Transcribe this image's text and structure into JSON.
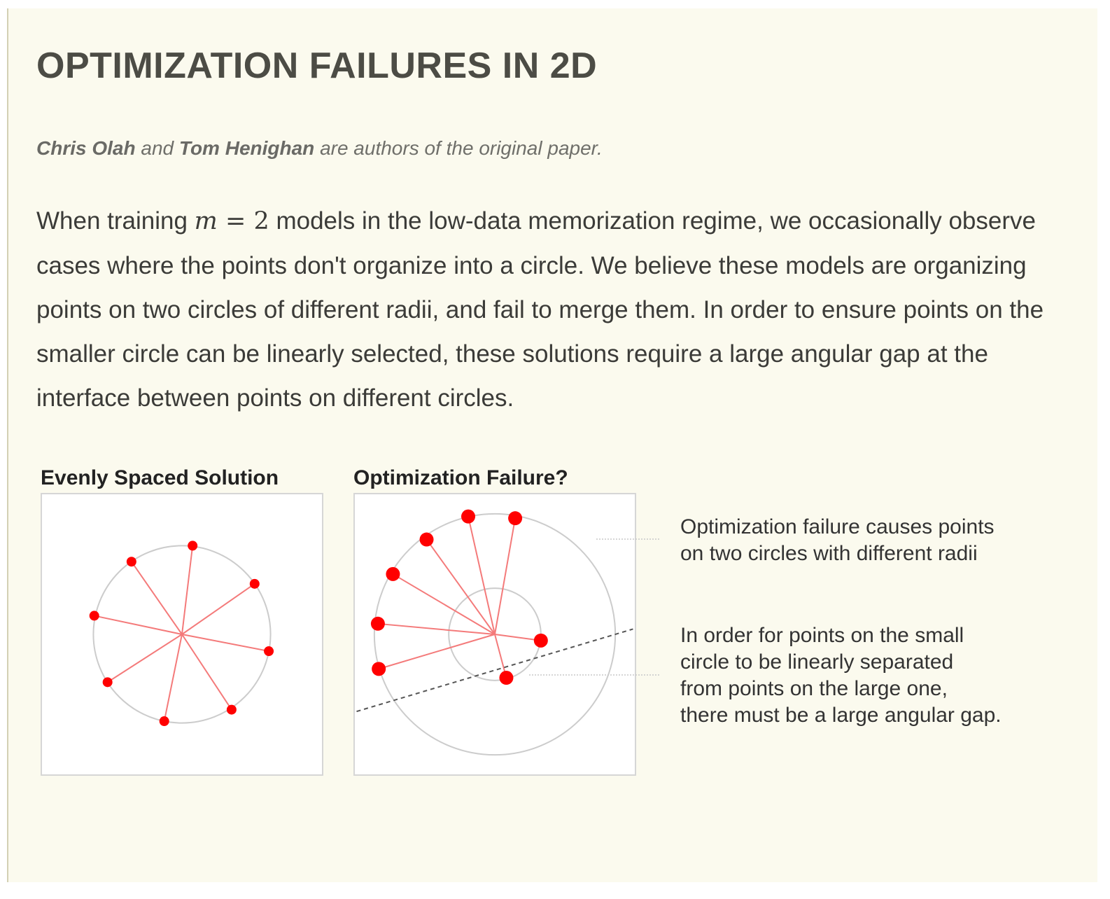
{
  "page": {
    "title": "OPTIMIZATION FAILURES IN 2D",
    "byline": {
      "author1": "Chris Olah",
      "connector": "and",
      "author2": "Tom Henighan",
      "rest": "are authors of the original paper."
    },
    "paragraph": {
      "before_math": "When training ",
      "math_var": "m",
      "math_op": " = ",
      "math_val": "2",
      "after_math": " models in the low-data memorization regime, we occasionally observe cases where the points don't organize into a circle. We believe these models are organizing points on two circles of different radii, and fail to merge them. In order to ensure points on the smaller circle can be linearly selected, these solutions require a large angular gap at the interface between points on different circles."
    }
  },
  "figures": {
    "left_title": "Evenly Spaced Solution",
    "right_title": "Optimization Failure?",
    "annotation_1": [
      "Optimization failure causes points",
      "on two circles with different radii"
    ],
    "annotation_2": [
      "In order for points on the small",
      "circle to be linearly separated",
      "from points on the large one,",
      "there must be a large angular gap."
    ]
  },
  "colors": {
    "point": "#ff0000",
    "spoke": "#f47a7a",
    "circle": "#cccccc",
    "separator": "#555555",
    "leader": "#c8c8c8"
  },
  "icons": {
    "point_marker": "filled-circle",
    "separator_line": "dashed-line"
  },
  "chart_data": [
    {
      "type": "scatter",
      "title": "Evenly Spaced Solution",
      "description_of_layout": "",
      "points": [
        {
          "x": 0.12,
          "y": 1.0
        },
        {
          "x": 0.82,
          "y": 0.57
        },
        {
          "x": 0.98,
          "y": -0.19
        },
        {
          "x": 0.56,
          "y": -0.85
        },
        {
          "x": -0.2,
          "y": -0.98
        },
        {
          "x": -0.84,
          "y": -0.54
        },
        {
          "x": -0.99,
          "y": 0.21
        },
        {
          "x": -0.57,
          "y": 0.82
        }
      ],
      "circles": [
        {
          "radius": 1.0
        }
      ],
      "xlim": [
        -1.58,
        1.58
      ],
      "ylim": [
        -1.58,
        1.58
      ]
    },
    {
      "type": "scatter",
      "title": "Optimization Failure?",
      "points": [
        {
          "x": -0.3,
          "y": 1.33
        },
        {
          "x": 0.23,
          "y": 1.31
        },
        {
          "x": -0.77,
          "y": 1.07
        },
        {
          "x": -1.15,
          "y": 0.68
        },
        {
          "x": -1.32,
          "y": 0.12
        },
        {
          "x": -1.31,
          "y": -0.39
        },
        {
          "x": 0.52,
          "y": -0.07
        },
        {
          "x": 0.13,
          "y": -0.49
        }
      ],
      "circles": [
        {
          "radius": 1.36
        },
        {
          "radius": 0.52
        }
      ],
      "separator": {
        "x1": -1.56,
        "y1": -0.87,
        "x2": 1.56,
        "y2": 0.06
      },
      "xlim": [
        -1.58,
        1.58
      ],
      "ylim": [
        -1.58,
        1.58
      ]
    }
  ]
}
